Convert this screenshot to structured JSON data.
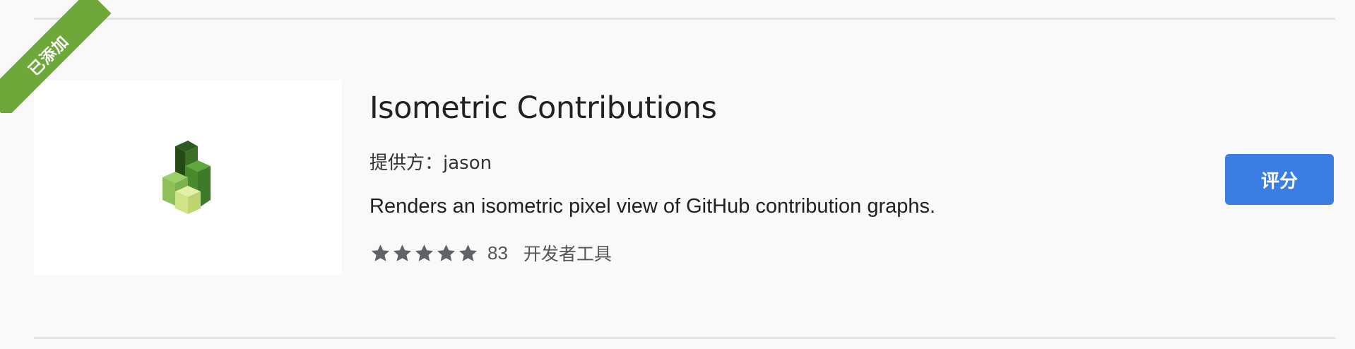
{
  "extension": {
    "badge": "已添加",
    "title": "Isometric Contributions",
    "provider_label": "提供方：",
    "provider_name": "jason",
    "description": "Renders an isometric pixel view of GitHub contribution graphs.",
    "rating_stars": 5,
    "rating_count": "83",
    "category": "开发者工具",
    "rate_button_label": "评分",
    "icon": "isometric-cubes-icon"
  },
  "colors": {
    "ribbon": "#6fa83a",
    "button": "#3b7ee3",
    "star": "#5f6368",
    "background": "#f9f9f9"
  }
}
